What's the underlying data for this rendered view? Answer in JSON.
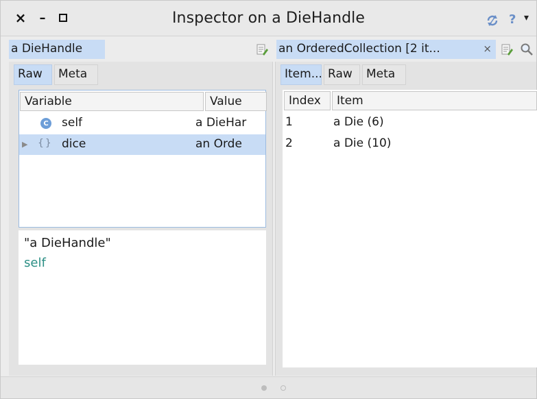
{
  "window": {
    "title": "Inspector on a DieHandle",
    "controls": {
      "close": "×",
      "minimize": "–",
      "help": "?",
      "menu": "▾"
    }
  },
  "left_pane": {
    "header": "a DieHandle",
    "tabs": [
      "Raw",
      "Meta"
    ],
    "active_tab": "Raw",
    "columns": [
      "Variable",
      "Value"
    ],
    "rows": [
      {
        "icon": "class-icon",
        "variable": "self",
        "value": "a DieHar",
        "selected": false
      },
      {
        "icon": "braces-icon",
        "variable": "dice",
        "value": "an Orde",
        "selected": true
      }
    ],
    "code": {
      "line1": "\"a DieHandle\"",
      "line2": "self"
    }
  },
  "right_pane": {
    "header": "an OrderedCollection [2 it...",
    "close": "×",
    "tabs": [
      "Item...",
      "Raw",
      "Meta"
    ],
    "active_tab": "Item...",
    "columns": [
      "Index",
      "Item"
    ],
    "rows": [
      {
        "index": "1",
        "item": "a Die (6)"
      },
      {
        "index": "2",
        "item": "a Die (10)"
      }
    ]
  },
  "footer": {
    "page_dots": 2,
    "active_dot": 1
  },
  "colors": {
    "selection": "#c8dcf5",
    "keyword": "#2c8f85",
    "accent_icon": "#6d9ed8"
  }
}
